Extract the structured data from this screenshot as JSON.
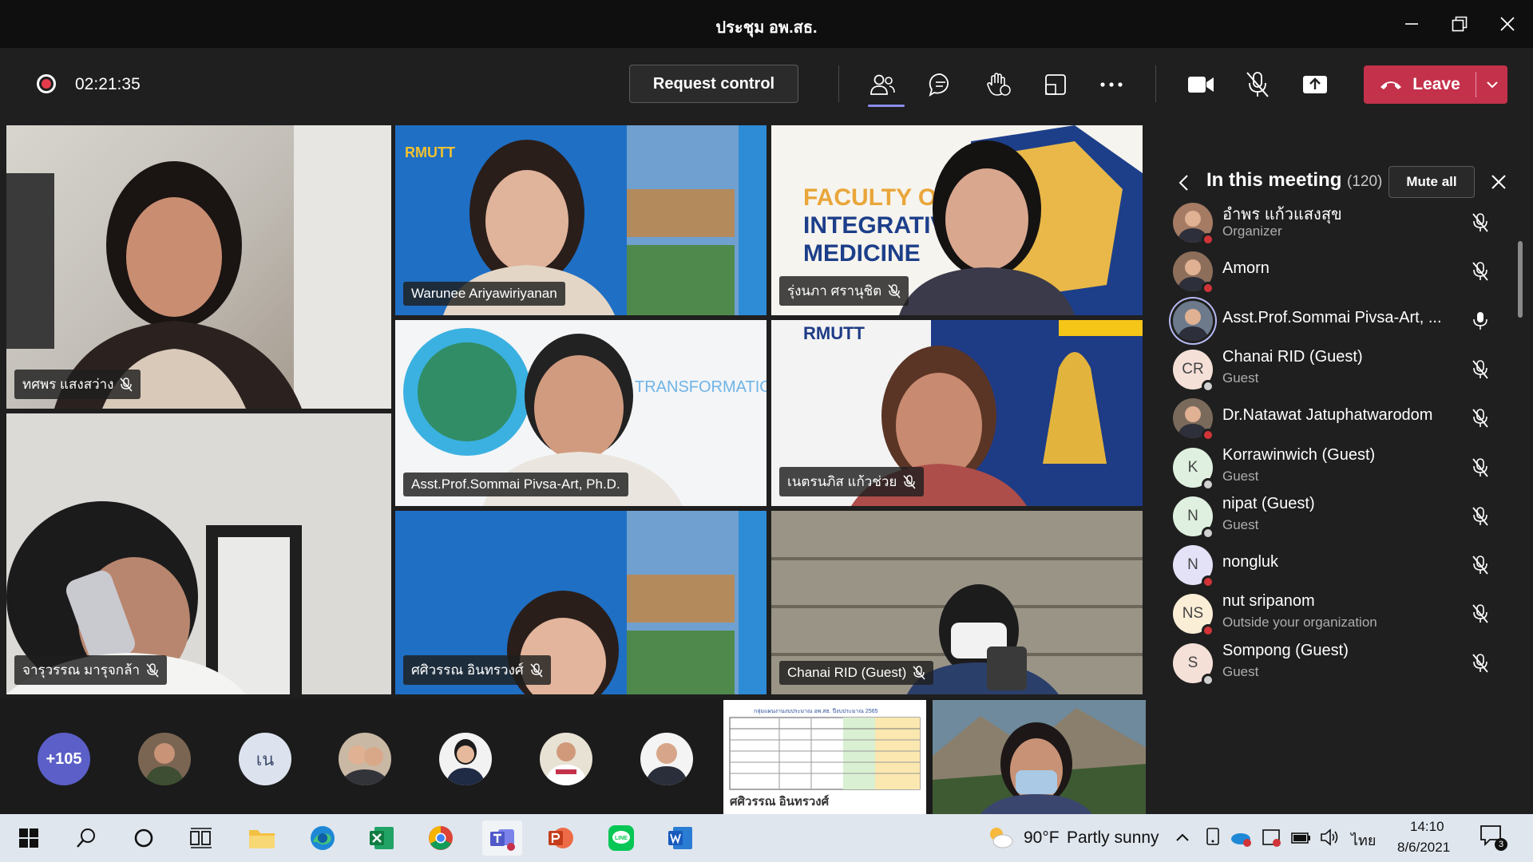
{
  "window": {
    "title": "ประชุม อพ.สธ."
  },
  "toolbar": {
    "timer": "02:21:35",
    "request_control": "Request control",
    "leave": "Leave"
  },
  "tiles": [
    {
      "name": "ทศพร แสงสว่าง"
    },
    {
      "name": "Warunee Ariyawiriyanan"
    },
    {
      "name": "รุ่งนภา ศรานุชิต"
    },
    {
      "name": "Asst.Prof.Sommai Pivsa-Art, Ph.D."
    },
    {
      "name": "เนตรนภิส แก้วช่วย"
    },
    {
      "name": "จารุวรรณ มารุจกล้า"
    },
    {
      "name": "ศศิวรรณ อินทรวงศ์"
    },
    {
      "name": "Chanai RID (Guest)"
    }
  ],
  "tile_backgrounds": {
    "warunee_slide_text": "RMUTT",
    "faculty_text_1": "FACULTY OF",
    "faculty_text_2": "INTEGRATIVE",
    "faculty_text_3": "MEDICINE",
    "transformation_text": "TRANSFORMATION",
    "rmutt_banner": "RMUTT"
  },
  "overflow": {
    "count_label": "+105",
    "initials_avatar": "เน"
  },
  "shared_content": {
    "caption": "ศศิวรรณ อินทรวงศ์",
    "sheet_title": "กลุ่มแผนงานงบประมาณ อพ.สธ. ปีงบประมาณ 2565"
  },
  "panel": {
    "title": "In this meeting",
    "count": "(120)",
    "mute_all": "Mute all",
    "participants": [
      {
        "name": "อำพร แก้วแสงสุข",
        "role": "Organizer",
        "initials": "",
        "status_color": "#d13438",
        "avatar_color": "#a57b64",
        "mic": "muted"
      },
      {
        "name": "Amorn",
        "role": "",
        "initials": "",
        "status_color": "#d13438",
        "avatar_color": "#8d6e5a",
        "mic": "muted"
      },
      {
        "name": "Asst.Prof.Sommai Pivsa-Art, ...",
        "role": "",
        "initials": "",
        "status_color": "",
        "avatar_color": "#6c7a8b",
        "mic": "on"
      },
      {
        "name": "Chanai RID (Guest)",
        "role": "Guest",
        "initials": "CR",
        "status_color": "#d1d1d1",
        "avatar_color": "#f5e0d8",
        "mic": "muted"
      },
      {
        "name": "Dr.Natawat Jatuphatwarodom",
        "role": "",
        "initials": "",
        "status_color": "#d13438",
        "avatar_color": "#7a6a5c",
        "mic": "muted"
      },
      {
        "name": "Korrawinwich (Guest)",
        "role": "Guest",
        "initials": "K",
        "status_color": "#d1d1d1",
        "avatar_color": "#dff0e0",
        "mic": "muted"
      },
      {
        "name": "nipat (Guest)",
        "role": "Guest",
        "initials": "N",
        "status_color": "#d1d1d1",
        "avatar_color": "#dff0e0",
        "mic": "muted"
      },
      {
        "name": "nongluk",
        "role": "",
        "initials": "N",
        "status_color": "#d13438",
        "avatar_color": "#e3e2f7",
        "mic": "muted"
      },
      {
        "name": "nut sripanom",
        "role": "Outside your organization",
        "initials": "NS",
        "status_color": "#d13438",
        "avatar_color": "#fbeed6",
        "mic": "muted"
      },
      {
        "name": "Sompong (Guest)",
        "role": "Guest",
        "initials": "S",
        "status_color": "#d1d1d1",
        "avatar_color": "#f5e0d8",
        "mic": "muted"
      }
    ]
  },
  "taskbar": {
    "temperature": "90°F",
    "weather": "Partly sunny",
    "language": "ไทย",
    "time": "14:10",
    "date": "8/6/2021",
    "notifications": "3",
    "apps": [
      "start-icon",
      "search-icon",
      "cortana-icon",
      "task-view-icon",
      "file-explorer-icon",
      "edge-icon",
      "excel-icon",
      "chrome-icon",
      "teams-icon",
      "powerpoint-icon",
      "line-icon",
      "word-icon"
    ]
  }
}
